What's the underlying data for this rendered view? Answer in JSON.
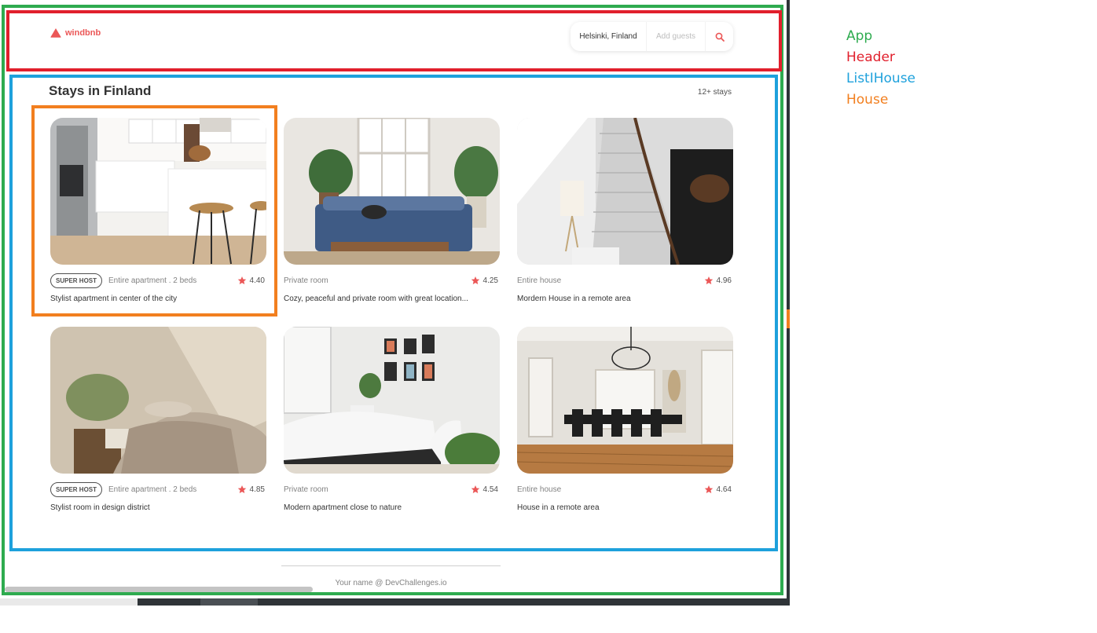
{
  "header": {
    "logo_text": "windbnb",
    "search": {
      "location": "Helsinki, Finland",
      "guests_placeholder": "Add guests"
    }
  },
  "list": {
    "title": "Stays in Finland",
    "count": "12+ stays",
    "houses": [
      {
        "superhost": true,
        "badge": "SUPER HOST",
        "type": "Entire apartment . 2 beds",
        "rating": "4.40",
        "title": "Stylist apartment in center of the city",
        "photo": "kitchen"
      },
      {
        "superhost": false,
        "type": "Private room",
        "rating": "4.25",
        "title": "Cozy, peaceful and private room with great location...",
        "photo": "bedroom-window"
      },
      {
        "superhost": false,
        "type": "Entire house",
        "rating": "4.96",
        "title": "Mordern House in a remote area",
        "photo": "staircase"
      },
      {
        "superhost": true,
        "badge": "SUPER HOST",
        "type": "Entire apartment . 2 beds",
        "rating": "4.85",
        "title": "Stylist room in design district",
        "photo": "bedroom-concrete"
      },
      {
        "superhost": false,
        "type": "Private room",
        "rating": "4.54",
        "title": "Modern apartment close to nature",
        "photo": "bedroom-frames"
      },
      {
        "superhost": false,
        "type": "Entire house",
        "rating": "4.64",
        "title": "House in a remote area",
        "photo": "dining-room"
      }
    ]
  },
  "footer": {
    "text": "Your name @ DevChallenges.io"
  },
  "legend": [
    {
      "label": "App",
      "color": "#2eab4f"
    },
    {
      "label": "Header",
      "color": "#e11f2c"
    },
    {
      "label": "ListIHouse",
      "color": "#1ea1dc"
    },
    {
      "label": "House",
      "color": "#f27f1f"
    }
  ],
  "colors": {
    "accent": "#eb5757",
    "text": "#333333",
    "muted": "#828282"
  }
}
